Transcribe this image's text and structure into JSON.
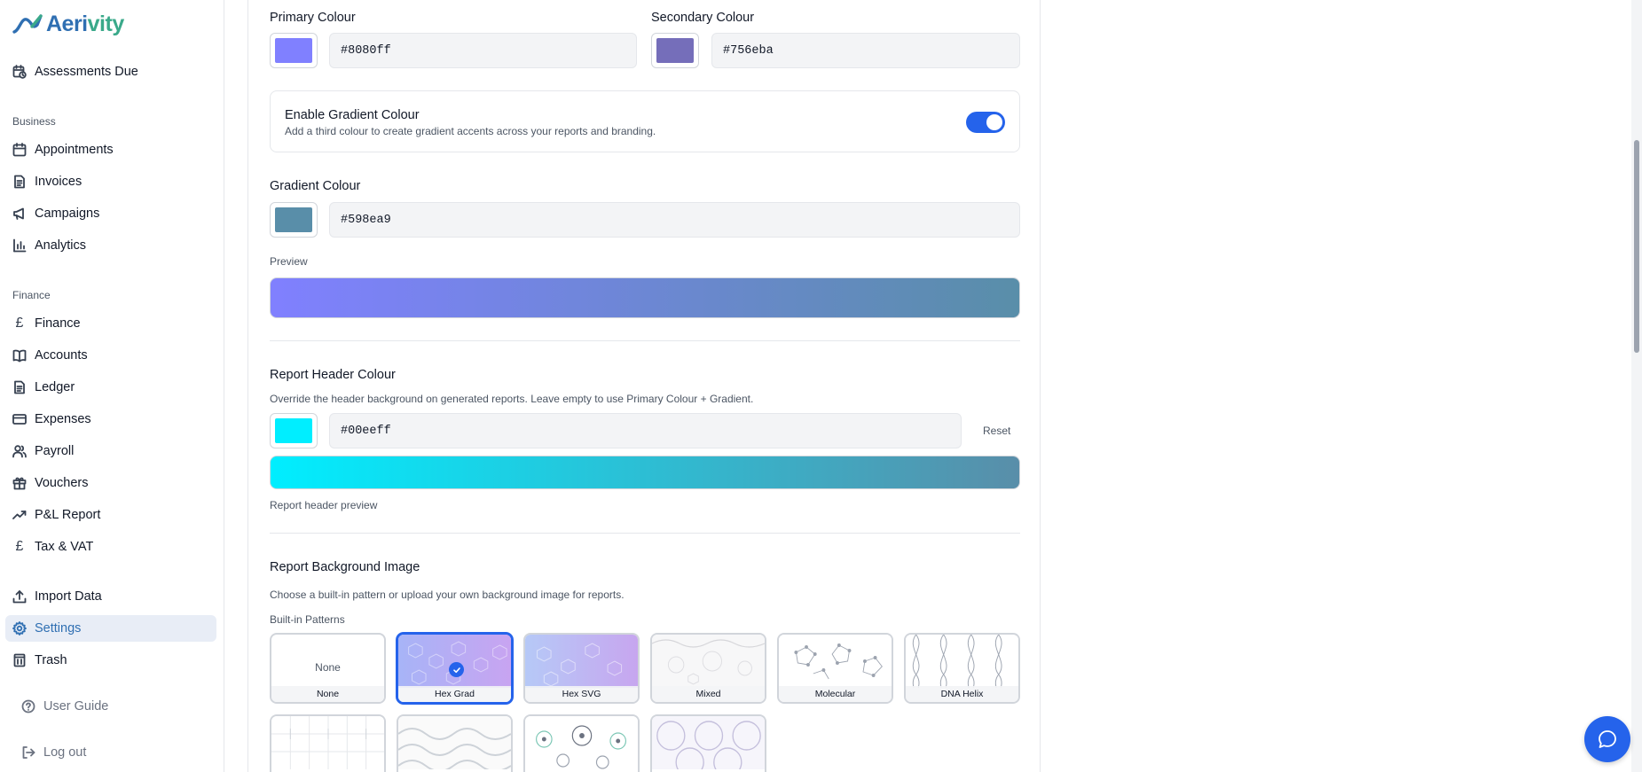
{
  "brand": {
    "name_primary": "Aeri",
    "name_accent": "vity"
  },
  "sidebar": {
    "top_item": "Assessments Due",
    "business_label": "Business",
    "business": [
      "Appointments",
      "Invoices",
      "Campaigns",
      "Analytics"
    ],
    "finance_label": "Finance",
    "finance": [
      "Finance",
      "Accounts",
      "Ledger",
      "Expenses",
      "Payroll",
      "Vouchers",
      "P&L Report",
      "Tax & VAT"
    ],
    "tools": [
      "Import Data",
      "Settings",
      "Trash"
    ],
    "active_item": "Settings",
    "footer": [
      "User Guide",
      "Log out"
    ]
  },
  "colours": {
    "primary_label": "Primary Colour",
    "primary_value": "#8080ff",
    "secondary_label": "Secondary Colour",
    "secondary_value": "#756eba",
    "gradient_toggle_title": "Enable Gradient Colour",
    "gradient_toggle_desc": "Add a third colour to create gradient accents across your reports and branding.",
    "gradient_enabled": true,
    "gradient_label": "Gradient Colour",
    "gradient_value": "#598ea9",
    "preview_label": "Preview"
  },
  "report_header": {
    "title": "Report Header Colour",
    "desc": "Override the header background on generated reports. Leave empty to use Primary Colour + Gradient.",
    "value": "#00eeff",
    "reset_label": "Reset",
    "preview_caption": "Report header preview"
  },
  "background_image": {
    "title": "Report Background Image",
    "desc": "Choose a built-in pattern or upload your own background image for reports.",
    "patterns_label": "Built-in Patterns",
    "none_text": "None",
    "patterns": [
      "None",
      "Hex Grad",
      "Hex SVG",
      "Mixed",
      "Molecular",
      "DNA Helix"
    ],
    "selected": "Hex Grad"
  },
  "icons": {
    "assessments": "calendar-clock-icon",
    "appointments": "calendar-icon",
    "invoices": "document-icon",
    "campaigns": "megaphone-icon",
    "analytics": "bar-chart-icon",
    "finance": "pound-icon",
    "accounts": "book-icon",
    "ledger": "ledger-icon",
    "expenses": "card-icon",
    "payroll": "users-icon",
    "vouchers": "gift-icon",
    "pl_report": "trend-up-icon",
    "tax": "pound-icon",
    "import": "upload-icon",
    "settings": "gear-icon",
    "trash": "trash-icon",
    "guide": "help-circle-icon",
    "logout": "logout-icon",
    "chat": "chat-icon",
    "check": "check-icon"
  },
  "theme": {
    "accent": "#2563eb",
    "brand_blue": "#2f6fb2",
    "brand_green": "#3aa98a"
  }
}
